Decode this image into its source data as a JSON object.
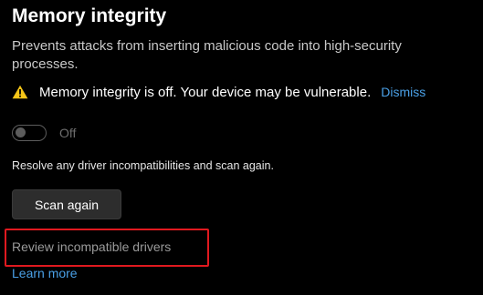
{
  "section": {
    "title": "Memory integrity",
    "description": "Prevents attacks from inserting malicious code into high-security processes."
  },
  "warning": {
    "icon": "warning-icon",
    "icon_color": "#f5c518",
    "text": "Memory integrity is off. Your device may be vulnerable.",
    "dismiss_label": "Dismiss"
  },
  "toggle": {
    "state": "off",
    "label": "Off"
  },
  "resolve_text": "Resolve any driver incompatibilities and scan again.",
  "scan_button_label": "Scan again",
  "review_link_label": "Review incompatible drivers",
  "learn_more_label": "Learn more",
  "colors": {
    "link": "#4aa0e6",
    "highlight_box": "#e0191f",
    "background": "#000000"
  }
}
